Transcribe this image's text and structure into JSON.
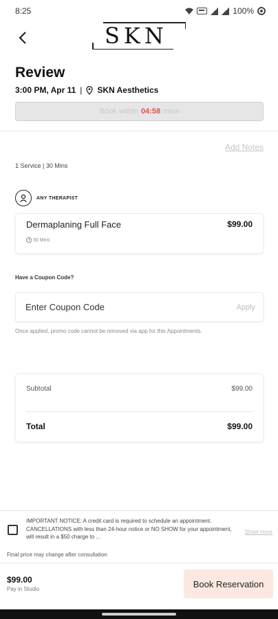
{
  "status_bar": {
    "time": "8:25",
    "battery": "100%"
  },
  "header": {
    "logo_text": "SKN",
    "title": "Review",
    "datetime": "3:00 PM, Apr 11",
    "separator": "|",
    "location": "SKN Aesthetics"
  },
  "timer": {
    "prefix": "Book within",
    "countdown": "04:58",
    "suffix": "mins"
  },
  "notes": {
    "add_notes_label": "Add Notes"
  },
  "summary": {
    "service_count": "1 Service | 30 Mins"
  },
  "therapist": {
    "label": "ANY THERAPIST"
  },
  "service": {
    "name": "Dermaplaning Full Face",
    "price": "$99.00",
    "duration": "30 Mins"
  },
  "coupon": {
    "question": "Have a Coupon Code?",
    "placeholder": "Enter Coupon Code",
    "apply_label": "Apply",
    "note": "Once applied, promo code cannot be removed via app for this Appointments."
  },
  "totals": {
    "subtotal_label": "Subtotal",
    "subtotal_value": "$99.00",
    "total_label": "Total",
    "total_value": "$99.00"
  },
  "notice": {
    "text": "IMPORTANT NOTICE: A credit card is required to schedule an appointment.  CANCELLATIONS with less than 24-hour notice or NO SHOW for your appointment, will result in a $50 charge to ...",
    "show_more": "Show more",
    "final_note": "Final price may change after consultation"
  },
  "footer": {
    "price": "$99.00",
    "pay_in": "Pay in Studio",
    "book_button": "Book Reservation"
  },
  "colors": {
    "timer_count": "#d9534f",
    "book_button_bg": "#fbe9e1"
  }
}
